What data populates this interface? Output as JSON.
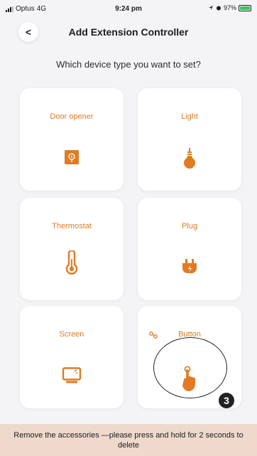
{
  "status_bar": {
    "carrier": "Optus",
    "network": "4G",
    "time": "9:24 pm",
    "battery": "97%",
    "battery_level": 0.97
  },
  "nav": {
    "back_label": "<",
    "title": "Add Extension Controller"
  },
  "question": "Which device type you want to set?",
  "devices": [
    {
      "label": "Door opener",
      "icon": "door-opener-icon"
    },
    {
      "label": "Light",
      "icon": "light-bulb-icon"
    },
    {
      "label": "Thermostat",
      "icon": "thermometer-icon"
    },
    {
      "label": "Plug",
      "icon": "plug-icon"
    },
    {
      "label": "Screen",
      "icon": "screen-icon"
    },
    {
      "label": "Button",
      "icon": "hand-pointer-icon"
    }
  ],
  "annotation": {
    "number": "3"
  },
  "footer": {
    "text": "Remove the accessories —please press and hold for 2 seconds to delete"
  },
  "colors": {
    "accent": "#e07b24",
    "footer_bg": "#efd9cd",
    "background": "#f4f4f6"
  }
}
